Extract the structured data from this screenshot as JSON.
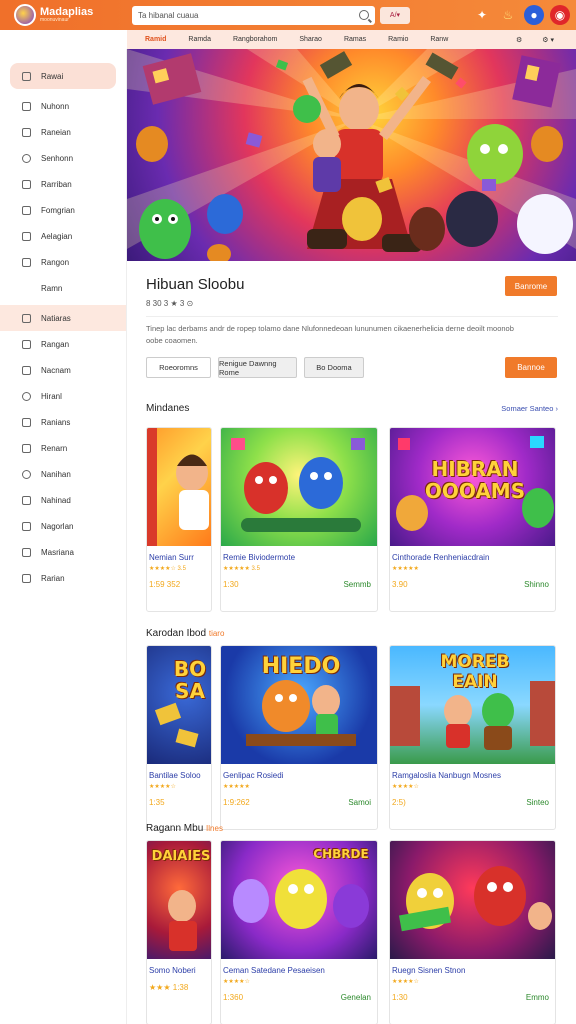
{
  "header": {
    "logo_title": "Madaplias",
    "logo_sub": "moonuvinaur",
    "search_value": "Ta hibanal cuaua",
    "lang_label": "A/▾"
  },
  "subnav": {
    "items": [
      "Ramid",
      "Ramda",
      "Rangborahom",
      "Sharao",
      "Ramas",
      "Ramio",
      "Ranw"
    ],
    "right": [
      "⚙",
      "⚙ ▾"
    ]
  },
  "sidebar": {
    "items": [
      {
        "label": "Rawai"
      },
      {
        "label": "Nuhonn"
      },
      {
        "label": "Raneian"
      },
      {
        "label": "Senhonn"
      },
      {
        "label": "Rarriban"
      },
      {
        "label": "Fomgrian"
      },
      {
        "label": "Aelagian"
      },
      {
        "label": "Rangon"
      },
      {
        "label": "Ramn"
      },
      {
        "label": "Natiaras"
      },
      {
        "label": "Rangan"
      },
      {
        "label": "Nacnam"
      },
      {
        "label": "Hiranl"
      },
      {
        "label": "Ranians"
      },
      {
        "label": "Renarn"
      },
      {
        "label": "Nanihan"
      },
      {
        "label": "Nahinad"
      },
      {
        "label": "Nagorlan"
      },
      {
        "label": "Masriana"
      },
      {
        "label": "Rarian"
      }
    ]
  },
  "game": {
    "title": "Hibuan Sloobu",
    "meta": "8 30 3 ★ 3 ⊙",
    "play_label": "Banrome",
    "description": "Tinep lac derbams andr de ropep tolamo dane Nlufonnedeoan lununumen cikaenerhelicia derne deoilt moonob oobe coaomen.",
    "action_label": "Bannoe",
    "buttons": [
      "Roeoromns",
      "Renigue Dawnng Rome",
      "Bo Dooma"
    ]
  },
  "sections": [
    {
      "title": "Mindanes",
      "highlight": "",
      "see_all": "Somaer Santeo",
      "cards": [
        {
          "name": "Nemian Surr",
          "stars": "★★★★☆ 3.5",
          "rating": "1:59 352",
          "action": ""
        },
        {
          "name": "Remie Biviodermote",
          "stars": "★★★★★ 3.5",
          "rating": "1:30",
          "action": "Semmb"
        },
        {
          "name": "Cinthorade Renheniacdrain",
          "stars": "★★★★★",
          "rating": "3.90",
          "action": "Shinno"
        }
      ]
    },
    {
      "title": "Karodan Ibod",
      "highlight": "tiaro",
      "see_all": "",
      "cards": [
        {
          "name": "Bantilae Soloo",
          "stars": "★★★★☆",
          "rating": "1:35",
          "action": ""
        },
        {
          "name": "Genlipac Rosiedi",
          "stars": "★★★★★",
          "rating": "1:9:262",
          "action": "Samoi"
        },
        {
          "name": "Ramgaloslia Nanbugn Mosnes",
          "stars": "★★★★☆",
          "rating": "2:5)",
          "action": "Sinteo"
        }
      ]
    },
    {
      "title": "Ragann Mbu",
      "highlight": "Ilnes",
      "see_all": "",
      "cards": [
        {
          "name": "Somo Noberi",
          "stars": "",
          "rating": "1:38",
          "action": ""
        },
        {
          "name": "Ceman Satedane Pesaeisen",
          "stars": "★★★★☆",
          "rating": "1:360",
          "action": "Genelan"
        },
        {
          "name": "Ruegn Sisnen Stnon",
          "stars": "★★★★☆",
          "rating": "1:30",
          "action": "Emmo"
        }
      ]
    }
  ],
  "thumb_text": {
    "c3": "HIBRAN OOOAMS",
    "c4": "BO SA",
    "c5": "HIEDO",
    "c6": "MOREB EAIN",
    "c7": "DAIAIES",
    "c8": "CHBRDE"
  }
}
